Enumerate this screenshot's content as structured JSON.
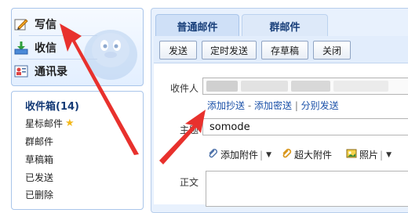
{
  "nav": {
    "compose": "写信",
    "inbox": "收信",
    "contacts": "通讯录"
  },
  "folders": {
    "title": "收件箱(14)",
    "items": [
      "星标邮件",
      "群邮件",
      "草稿箱",
      "已发送",
      "已删除"
    ]
  },
  "tabs": [
    "普通邮件",
    "群邮件"
  ],
  "toolbar": {
    "send": "发送",
    "scheduled": "定时发送",
    "save_draft": "存草稿",
    "close": "关闭"
  },
  "form": {
    "recipient_label": "收件人",
    "links": {
      "cc": "添加抄送",
      "dash": " - ",
      "bcc": "添加密送",
      "bar": " | ",
      "separate": "分别发送"
    },
    "subject_label": "主题",
    "subject_value": "somode",
    "attach": "添加附件",
    "big_attach": "超大附件",
    "photo": "照片",
    "body_label": "正文"
  },
  "colors": {
    "annotation_arrow": "#e8312d",
    "link": "#1a50a8",
    "star": "#f3b81a"
  },
  "icons": [
    "pencil-icon",
    "inbox-download-icon",
    "contacts-card-icon",
    "star-icon",
    "paperclip-icon",
    "photo-icon",
    "penguin-icon"
  ]
}
